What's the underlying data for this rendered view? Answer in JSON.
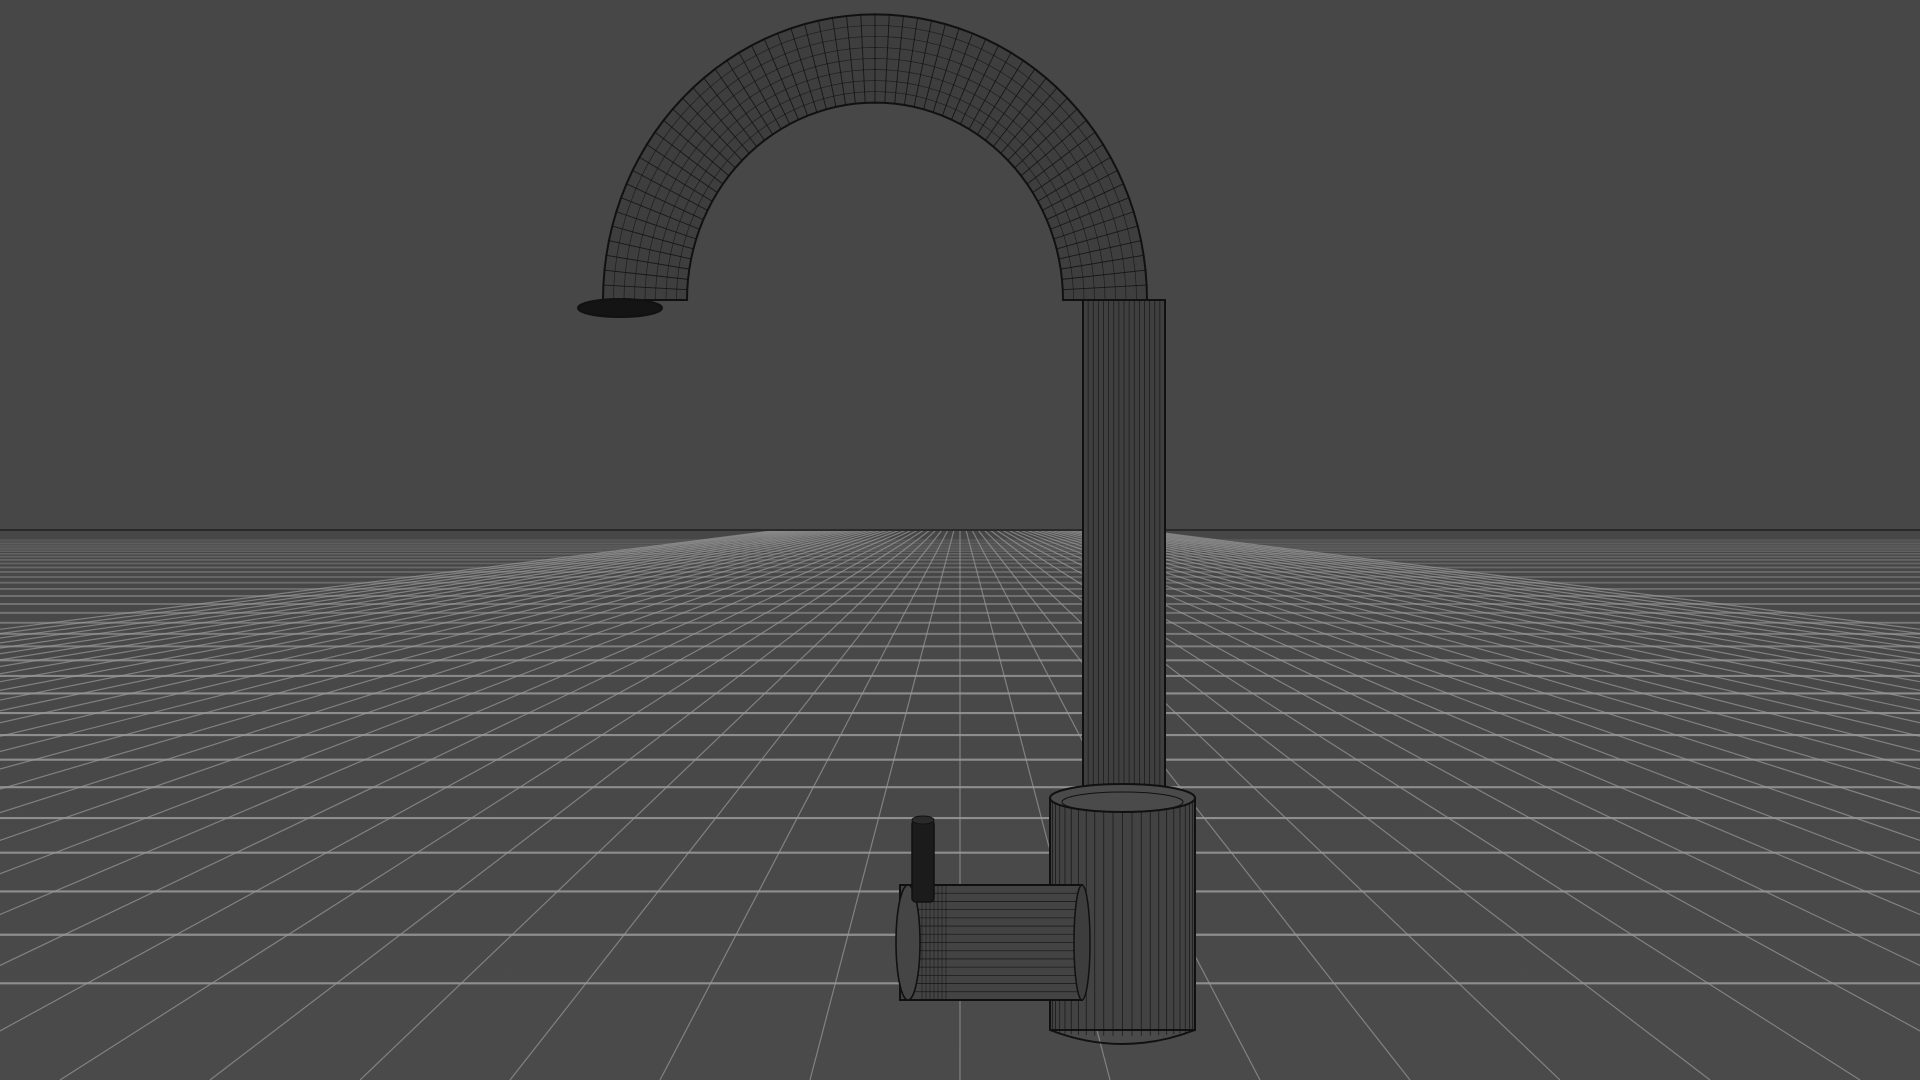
{
  "viewport": {
    "background_color": "#474747",
    "grid_line_color": "#9a9a9a",
    "horizon_line_color": "#2a2a2a",
    "wire_color": "#111111",
    "view_mode": "wireframe"
  },
  "scene_objects": [
    {
      "name": "faucet-spout",
      "type": "curved-pipe-mesh"
    },
    {
      "name": "faucet-body",
      "type": "cylinder-mesh"
    },
    {
      "name": "faucet-lever-housing",
      "type": "cylinder-mesh"
    },
    {
      "name": "faucet-lever-handle",
      "type": "cylinder-mesh"
    }
  ]
}
